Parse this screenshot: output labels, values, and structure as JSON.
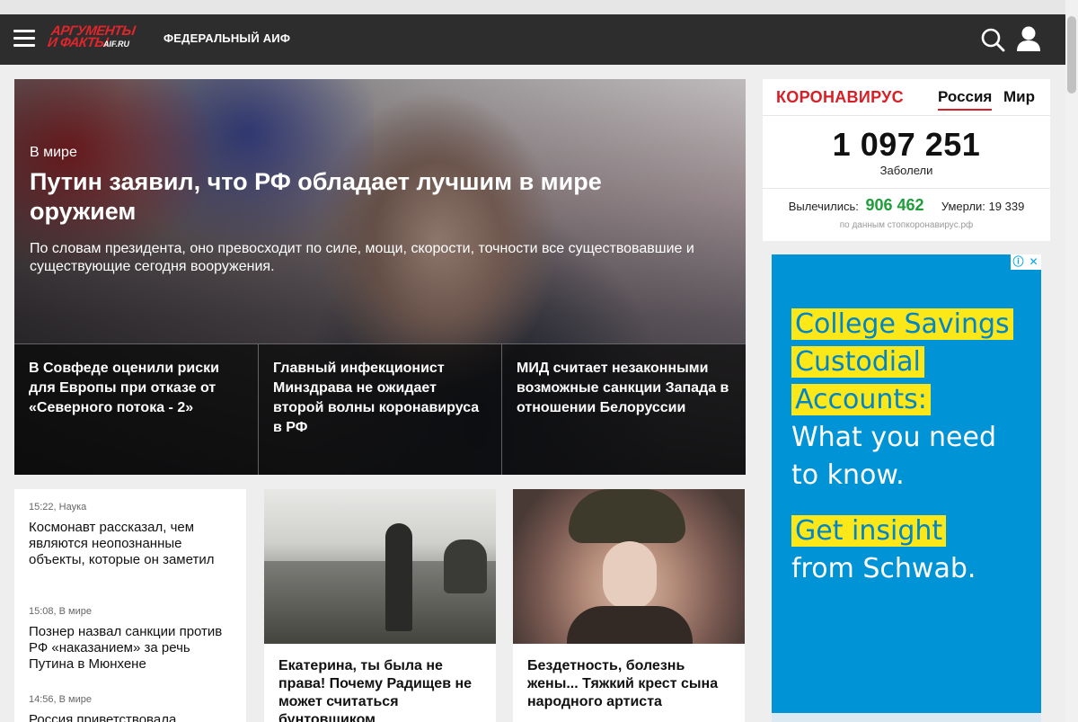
{
  "header": {
    "logo_line1": "АРГУМЕНТЫ",
    "logo_line2": "И ФАКТЫ",
    "logo_site": "AIF.RU",
    "region": "ФЕДЕРАЛЬНЫЙ АИФ",
    "icons": [
      "menu-icon",
      "search-icon",
      "user-icon"
    ]
  },
  "hero": {
    "category": "В мире",
    "title": "Путин заявил, что РФ обладает лучшим в мире оружием",
    "lead": "По словам президента, оно превосходит по силе, мощи, скорости, точности все существовавшие и существующие сегодня вооружения.",
    "sub_items": [
      "В Совфеде оценили риски для Европы при отказе от «Северного потока - 2»",
      "Главный инфекционист Минздрава не ожидает второй волны коронавируса в РФ",
      "МИД считает незаконными возможные санкции Запада в отношении Белоруссии"
    ]
  },
  "corona": {
    "title": "КОРОНАВИРУС",
    "tabs": [
      "Россия",
      "Мир"
    ],
    "active_tab": "Россия",
    "cases": "1 097 251",
    "cases_label": "Заболели",
    "recovered_label": "Вылечились:",
    "recovered": "906 462",
    "deaths_label": "Умерли:",
    "deaths": "19 339",
    "source": "по данным стопкоронавирус.рф",
    "accent_color": "#d71f26",
    "recovered_color": "#1e9d38"
  },
  "ad": {
    "line1": "College Savings",
    "line2": "Custodial",
    "line3": "Accounts:",
    "line4": "What you need",
    "line5": "to know.",
    "line6": "Get insight",
    "line7": "from Schwab.",
    "info_icon": "ⓘ",
    "close_icon": "✕",
    "bg_color": "#0093d5",
    "highlight_color": "#fce819"
  },
  "news_list": [
    {
      "meta": "15:22, Наука",
      "head": "Космонавт рассказал, чем являются неопознанные объекты, которые он заметил"
    },
    {
      "meta": "15:08, В мире",
      "head": "Познер назвал санкции против РФ «наказанием» за речь Путина в Мюнхене"
    },
    {
      "meta": "14:56, В мире",
      "head": "Россия приветствовала"
    }
  ],
  "cards": [
    {
      "title": "Екатерина, ты была не права! Почему Радищев не может считаться бунтовщиком"
    },
    {
      "title": "Бездетность, болезнь жены... Тяжкий крест сына народного артиста"
    }
  ]
}
